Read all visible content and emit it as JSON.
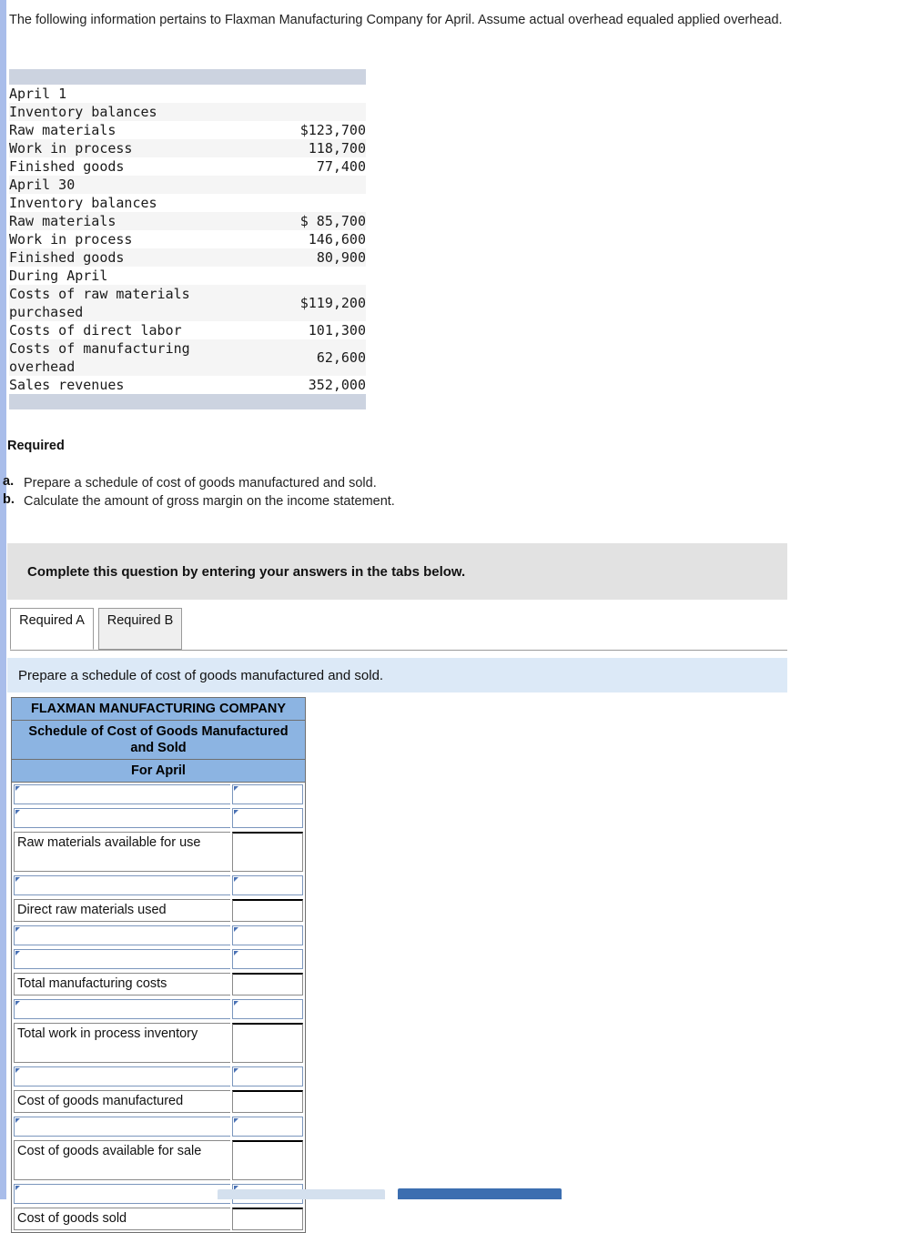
{
  "intro": {
    "text": "The following information pertains to Flaxman Manufacturing Company for April. Assume actual overhead equaled applied overhead."
  },
  "data_table": {
    "rows": [
      {
        "label": "April 1",
        "value": "",
        "indent": 0,
        "stripe": false
      },
      {
        "label": "Inventory balances",
        "value": "",
        "indent": 0,
        "stripe": true
      },
      {
        "label": "Raw materials",
        "value": "$123,700",
        "indent": 1,
        "stripe": false
      },
      {
        "label": "Work in process",
        "value": "118,700",
        "indent": 1,
        "stripe": true
      },
      {
        "label": "Finished goods",
        "value": "77,400",
        "indent": 1,
        "stripe": false
      },
      {
        "label": "April 30",
        "value": "",
        "indent": 0,
        "stripe": true
      },
      {
        "label": "Inventory balances",
        "value": "",
        "indent": 0,
        "stripe": false
      },
      {
        "label": "Raw materials",
        "value": "$ 85,700",
        "indent": 1,
        "stripe": true
      },
      {
        "label": "Work in process",
        "value": "146,600",
        "indent": 1,
        "stripe": false
      },
      {
        "label": "Finished goods",
        "value": "80,900",
        "indent": 1,
        "stripe": true
      },
      {
        "label": "During April",
        "value": "",
        "indent": 0,
        "stripe": false
      },
      {
        "label": "Costs of raw materials\npurchased",
        "value": "$119,200",
        "indent": 0,
        "stripe": true
      },
      {
        "label": "Costs of direct labor",
        "value": "101,300",
        "indent": 0,
        "stripe": false
      },
      {
        "label": "Costs of manufacturing\noverhead",
        "value": "62,600",
        "indent": 0,
        "stripe": true
      },
      {
        "label": "Sales revenues",
        "value": "352,000",
        "indent": 0,
        "stripe": false
      }
    ]
  },
  "required": {
    "heading": "Required",
    "items": [
      {
        "marker": "a.",
        "text": "Prepare a schedule of cost of goods manufactured and sold."
      },
      {
        "marker": "b.",
        "text": "Calculate the amount of gross margin on the income statement."
      }
    ]
  },
  "instruction_banner": {
    "text": "Complete this question by entering your answers in the tabs below."
  },
  "tabs": [
    {
      "label": "Required\nA",
      "active": true
    },
    {
      "label": "Required\nB",
      "active": false
    }
  ],
  "prompt_bar": {
    "text": "Prepare a schedule of cost of goods manufactured and sold."
  },
  "schedule_form": {
    "headers": [
      "FLAXMAN MANUFACTURING COMPANY",
      "Schedule of Cost of Goods Manufactured and Sold",
      "For April"
    ],
    "rows": [
      {
        "label": "",
        "editable": true,
        "tall": false,
        "subtotal": false,
        "value": ""
      },
      {
        "label": "",
        "editable": true,
        "tall": false,
        "subtotal": false,
        "value": ""
      },
      {
        "label": "Raw materials available for use",
        "editable": false,
        "tall": true,
        "subtotal": true,
        "value": ""
      },
      {
        "label": "",
        "editable": true,
        "tall": false,
        "subtotal": false,
        "value": ""
      },
      {
        "label": "Direct raw materials used",
        "editable": false,
        "tall": false,
        "subtotal": true,
        "value": ""
      },
      {
        "label": "",
        "editable": true,
        "tall": false,
        "subtotal": false,
        "value": ""
      },
      {
        "label": "",
        "editable": true,
        "tall": false,
        "subtotal": false,
        "value": ""
      },
      {
        "label": "Total manufacturing costs",
        "editable": false,
        "tall": false,
        "subtotal": true,
        "value": ""
      },
      {
        "label": "",
        "editable": true,
        "tall": false,
        "subtotal": false,
        "value": ""
      },
      {
        "label": "Total work in process inventory",
        "editable": false,
        "tall": true,
        "subtotal": true,
        "value": ""
      },
      {
        "label": "",
        "editable": true,
        "tall": false,
        "subtotal": false,
        "value": ""
      },
      {
        "label": "Cost of goods manufactured",
        "editable": false,
        "tall": false,
        "subtotal": true,
        "value": ""
      },
      {
        "label": "",
        "editable": true,
        "tall": false,
        "subtotal": false,
        "value": ""
      },
      {
        "label": "Cost of goods available for sale",
        "editable": false,
        "tall": true,
        "subtotal": true,
        "value": ""
      },
      {
        "label": "",
        "editable": true,
        "tall": false,
        "subtotal": false,
        "value": ""
      },
      {
        "label": "Cost of goods sold",
        "editable": false,
        "tall": false,
        "subtotal": true,
        "value": ""
      }
    ]
  },
  "nav_buttons": [
    {
      "name": "previous-button",
      "color": "#d4e0ee"
    },
    {
      "name": "next-button",
      "color": "#3c6eb0"
    }
  ],
  "colors": {
    "accent_bar": "#a9bdea",
    "table_cap": "#ccd3e0",
    "form_header_blue": "#8cb4e2",
    "prompt_blue": "#dce9f7",
    "banner_grey": "#e2e2e2"
  }
}
